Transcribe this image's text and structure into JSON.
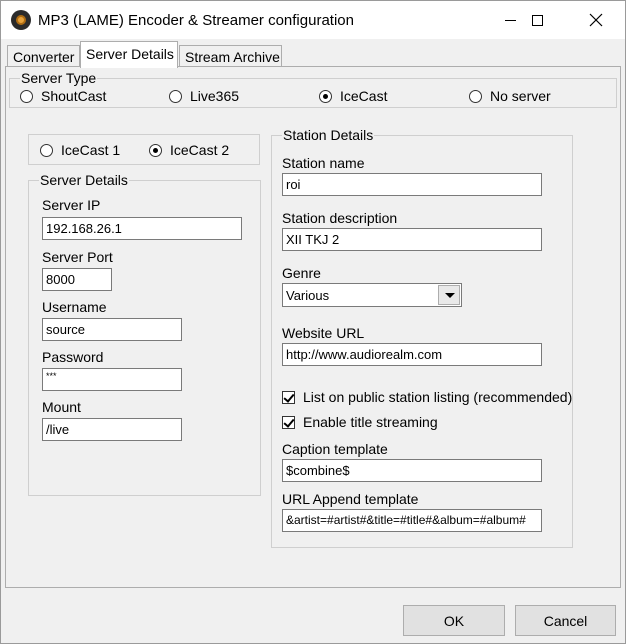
{
  "window": {
    "title": "MP3 (LAME) Encoder & Streamer configuration",
    "app_icon": "lame-encoder-icon"
  },
  "tabs": [
    {
      "label": "Converter",
      "active": false
    },
    {
      "label": "Server Details",
      "active": true
    },
    {
      "label": "Stream Archive",
      "active": false
    }
  ],
  "server_type": {
    "legend": "Server Type",
    "options": [
      {
        "label": "ShoutCast",
        "selected": false
      },
      {
        "label": "Live365",
        "selected": false
      },
      {
        "label": "IceCast",
        "selected": true
      },
      {
        "label": "No server",
        "selected": false
      }
    ]
  },
  "icecast_version": {
    "options": [
      {
        "label": "IceCast 1",
        "selected": false
      },
      {
        "label": "IceCast 2",
        "selected": true
      }
    ]
  },
  "server_details": {
    "legend": "Server Details",
    "server_ip_label": "Server IP",
    "server_ip": "192.168.26.1",
    "server_port_label": "Server Port",
    "server_port": "8000",
    "username_label": "Username",
    "username": "source",
    "password_label": "Password",
    "password": "***",
    "mount_label": "Mount",
    "mount": "/live"
  },
  "station_details": {
    "legend": "Station Details",
    "station_name_label": "Station name",
    "station_name": "roi",
    "station_description_label": "Station description",
    "station_description": "XII TKJ 2",
    "genre_label": "Genre",
    "genre": "Various",
    "website_url_label": "Website URL",
    "website_url": "http://www.audiorealm.com",
    "list_public_label": "List on public station listing (recommended)",
    "list_public_checked": true,
    "enable_title_label": "Enable title streaming",
    "enable_title_checked": true,
    "caption_template_label": "Caption template",
    "caption_template": "$combine$",
    "url_append_label": "URL Append template",
    "url_append": "&artist=#artist#&title=#title#&album=#album#"
  },
  "buttons": {
    "ok": "OK",
    "cancel": "Cancel"
  }
}
